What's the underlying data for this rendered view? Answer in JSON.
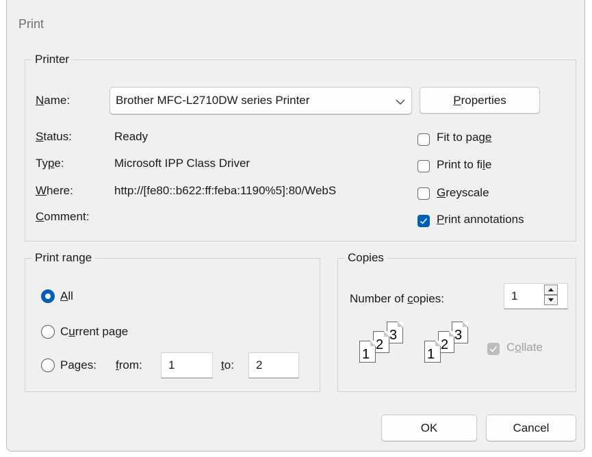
{
  "window": {
    "title": "Print"
  },
  "printer": {
    "legend": "Printer",
    "name_label_pre": "",
    "name_label_u": "N",
    "name_label_post": "ame:",
    "name_value": "Brother MFC-L2710DW series Printer",
    "properties_u": "P",
    "properties_post": "roperties",
    "status_u": "S",
    "status_post": "tatus:",
    "status_value": "Ready",
    "type_pre": "Ty",
    "type_u": "p",
    "type_post": "e:",
    "type_value": "Microsoft IPP Class Driver",
    "where_u": "W",
    "where_post": "here:",
    "where_value": "http://[fe80::b622:ff:feba:1190%5]:80/WebS",
    "comment_u": "C",
    "comment_post": "omment:",
    "options": [
      {
        "pre": "Fit to pag",
        "u": "e",
        "post": "",
        "checked": false
      },
      {
        "pre": "Print to fi",
        "u": "l",
        "post": "e",
        "checked": false
      },
      {
        "pre": "",
        "u": "G",
        "post": "reyscale",
        "checked": false
      },
      {
        "pre": "",
        "u": "P",
        "post": "rint annotations",
        "checked": true
      }
    ]
  },
  "range": {
    "legend": "Print range",
    "all_u": "A",
    "all_post": "ll",
    "current_pre": "C",
    "current_u": "u",
    "current_post": "rrent page",
    "pages_pre": "Pa",
    "pages_u": "g",
    "pages_post": "es:",
    "from_u": "f",
    "from_post": "rom:",
    "from_value": "1",
    "to_u": "t",
    "to_post": "o:",
    "to_value": "2",
    "selected": "All"
  },
  "copies": {
    "legend": "Copies",
    "number_pre": "Number of ",
    "number_u": "c",
    "number_post": "opies:",
    "number_value": "1",
    "collate_pre": "C",
    "collate_u": "o",
    "collate_post": "llate",
    "collate_checked": true,
    "collate_disabled": true,
    "page_numbers": [
      "1",
      "2",
      "3"
    ]
  },
  "buttons": {
    "ok": "OK",
    "cancel": "Cancel"
  },
  "colors": {
    "accent": "#005fb8",
    "dialog_bg": "#f0f0f0",
    "border": "#d2d2d2"
  }
}
